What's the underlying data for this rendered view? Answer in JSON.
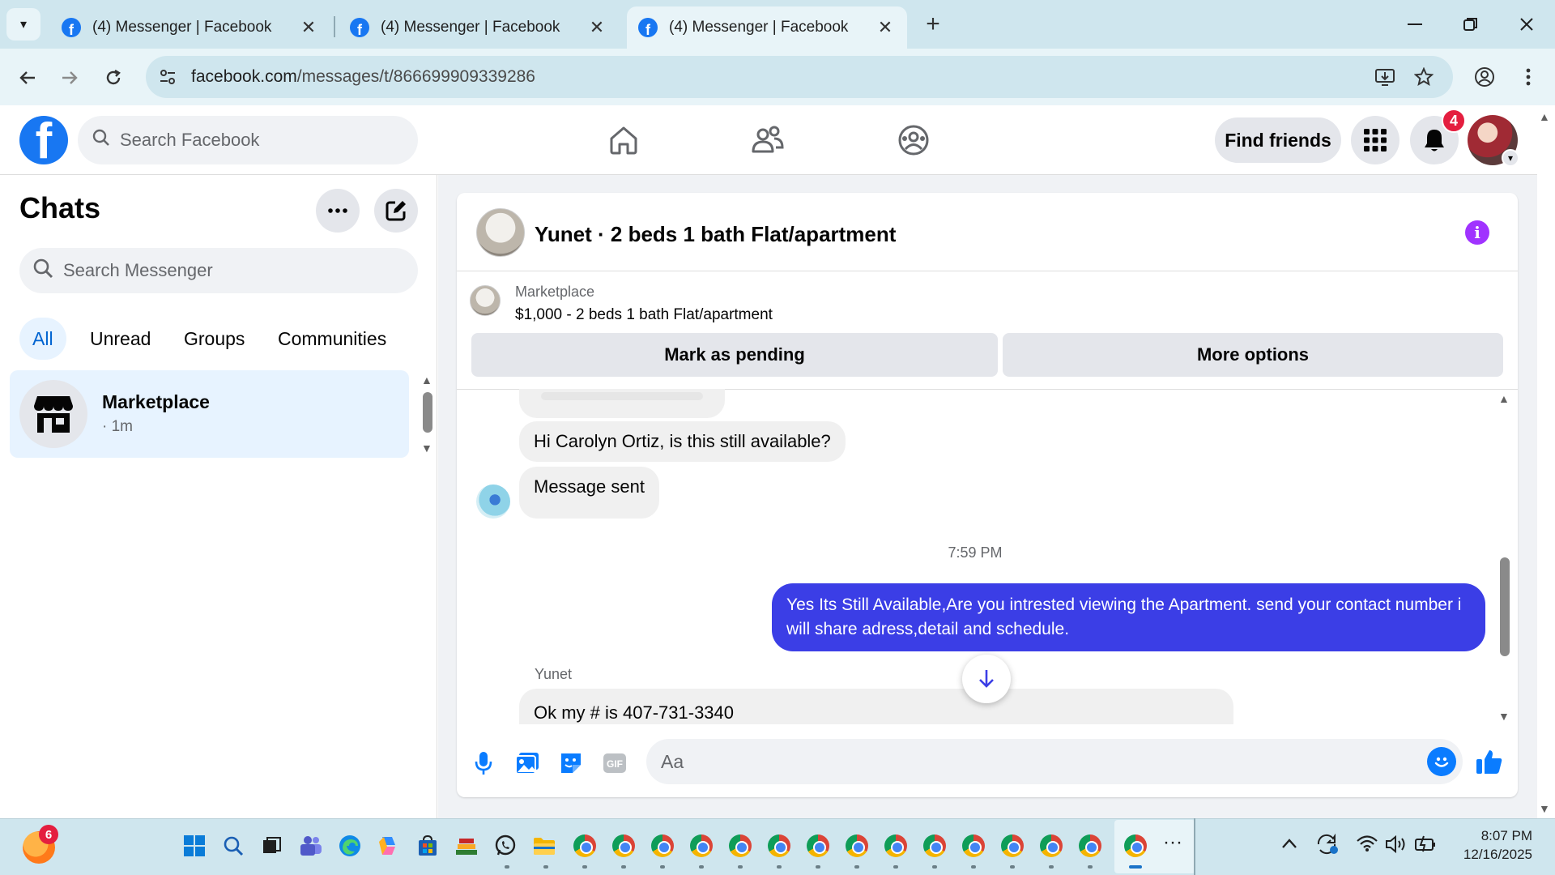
{
  "browser": {
    "tabs": [
      {
        "title": "(4) Messenger | Facebook",
        "active": false
      },
      {
        "title": "(4) Messenger | Facebook",
        "active": false
      },
      {
        "title": "(4) Messenger | Facebook",
        "active": true
      }
    ],
    "url_host": "facebook.com",
    "url_path": "/messages/t/866699909339286",
    "new_tab_glyph": "+",
    "close_glyph": "✕"
  },
  "facebook": {
    "search_placeholder": "Search Facebook",
    "find_friends_label": "Find friends",
    "notification_count": "4",
    "brand_color": "#1877f2"
  },
  "sidebar": {
    "title": "Chats",
    "search_placeholder": "Search Messenger",
    "filters": [
      {
        "label": "All",
        "active": true
      },
      {
        "label": "Unread",
        "active": false
      },
      {
        "label": "Groups",
        "active": false
      },
      {
        "label": "Communities",
        "active": false
      }
    ],
    "chats": [
      {
        "name": "Marketplace",
        "time": "· 1m",
        "selected": true
      }
    ]
  },
  "conversation": {
    "title": "Yunet · 2 beds 1 bath Flat/apartment",
    "listing": {
      "source": "Marketplace",
      "summary": "$1,000 - 2 beds 1 bath Flat/apartment"
    },
    "actions": {
      "mark_pending": "Mark as pending",
      "more_options": "More options"
    },
    "messages": [
      {
        "direction": "in",
        "text": "Hi Carolyn Ortiz, is this still available?"
      },
      {
        "direction": "in",
        "text": "Message sent"
      },
      {
        "type": "timestamp",
        "text": "7:59 PM"
      },
      {
        "direction": "out",
        "text": "Yes Its Still Available,Are you intrested viewing the Apartment. send your contact number i will share adress,detail and schedule."
      },
      {
        "type": "sender",
        "text": "Yunet"
      },
      {
        "direction": "in",
        "text": "Ok my # is 407-731-3340"
      }
    ],
    "composer_placeholder": "Aa",
    "outgoing_color": "#3b3ee6",
    "accent_color": "#a033ff"
  },
  "taskbar": {
    "weather_badge": "6",
    "time": "8:07 PM",
    "date": "12/16/2025",
    "more_glyph": "···"
  }
}
